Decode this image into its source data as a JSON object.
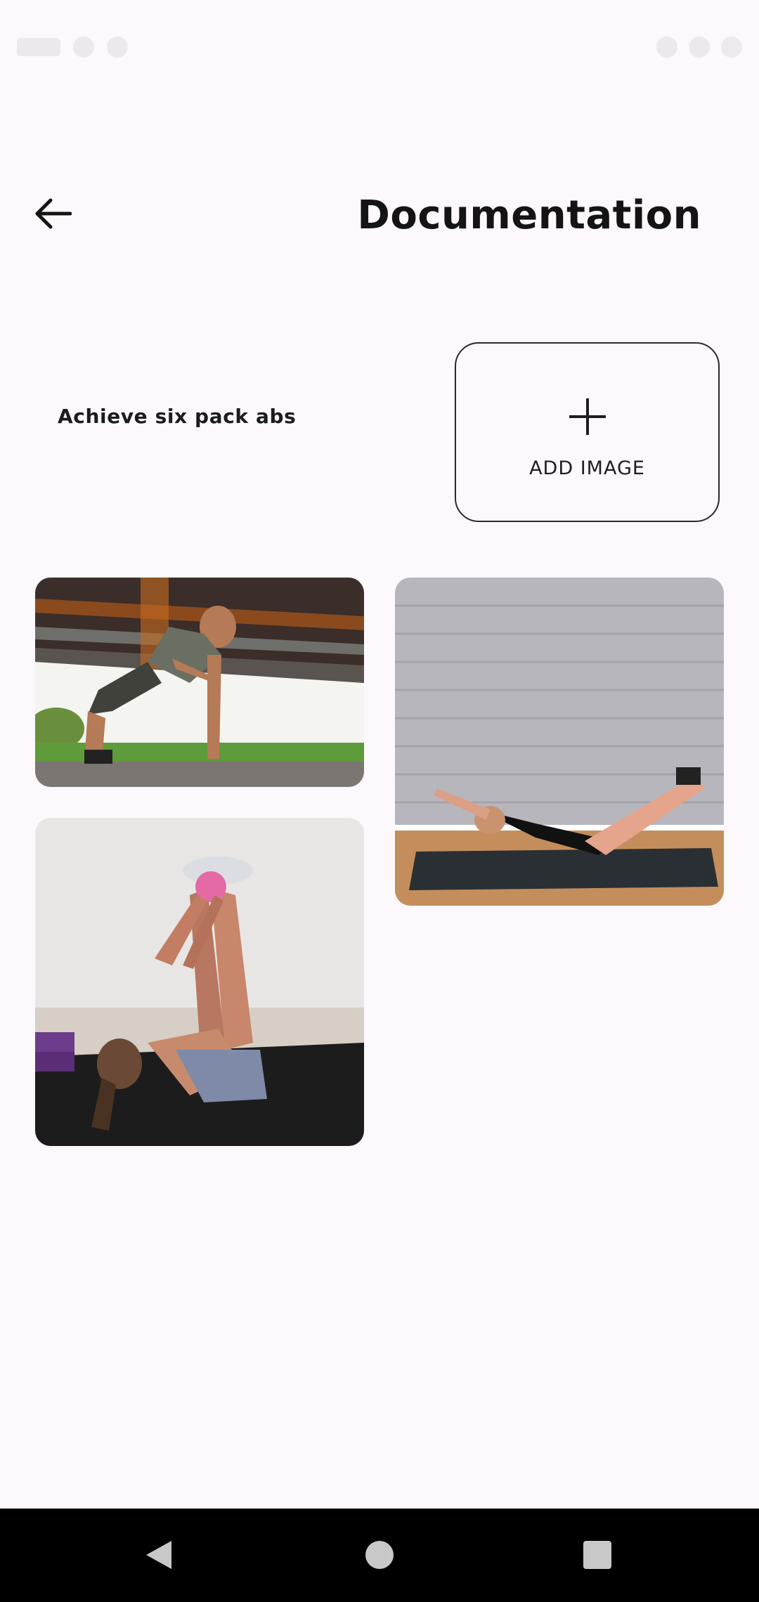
{
  "header": {
    "title": "Documentation",
    "back_icon": "arrow-left-icon"
  },
  "goal": {
    "label": "Achieve six pack abs"
  },
  "add_image": {
    "label": "ADD IMAGE",
    "icon": "plus-icon"
  },
  "gallery": {
    "images": [
      {
        "subject": "push-up"
      },
      {
        "subject": "v-ups"
      },
      {
        "subject": "toe-reach"
      }
    ]
  },
  "nav_bar": {
    "back_icon": "triangle-back-icon",
    "home_icon": "circle-home-icon",
    "recents_icon": "square-recents-icon"
  },
  "colors": {
    "background": "#fdf8fb",
    "text": "#141414",
    "nav_bar": "#000000",
    "nav_icon": "#c8c8c8"
  }
}
